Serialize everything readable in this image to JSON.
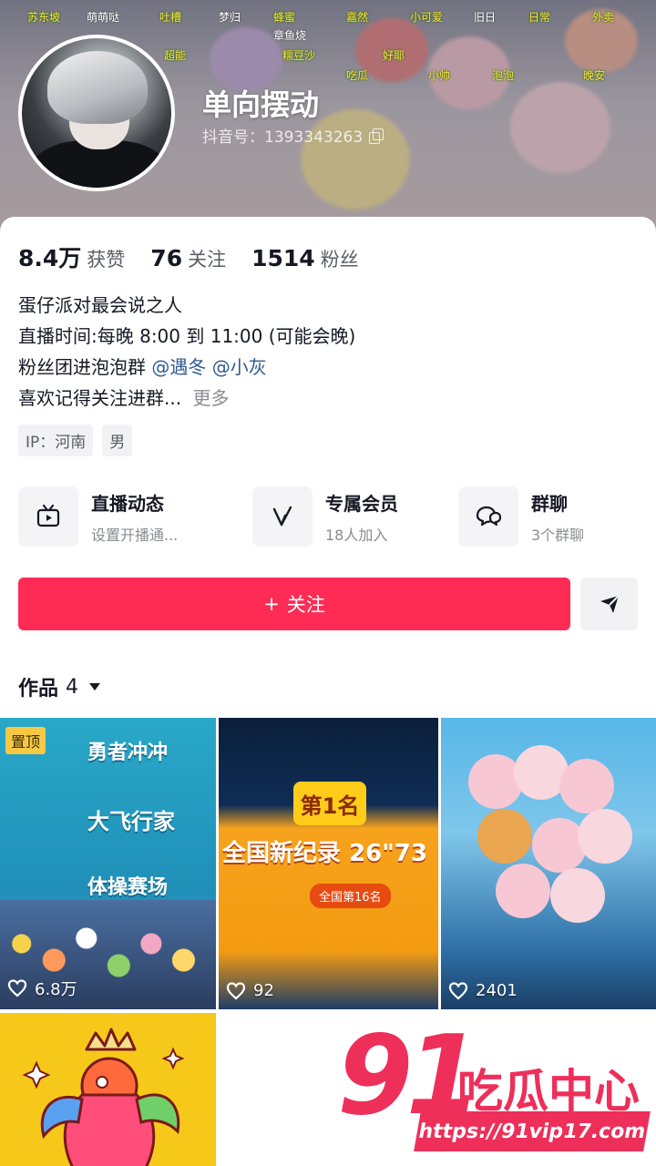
{
  "profile": {
    "username": "单向摆动",
    "douyin_id": "抖音号：1393343263"
  },
  "banner_danmaku": [
    "苏东坡",
    "萌萌哒",
    "吐槽",
    "梦归",
    "蜂蜜",
    "嘉然",
    "小可爱",
    "旧日",
    "日常",
    "外卖",
    "章鱼烧",
    "糯豆沙",
    "好耶",
    "超能",
    "小帅",
    "泡泡",
    "吃瓜",
    "晚安"
  ],
  "stats": [
    {
      "num": "8.4万",
      "label": "获赞"
    },
    {
      "num": "76",
      "label": "关注"
    },
    {
      "num": "1514",
      "label": "粉丝"
    }
  ],
  "bio": {
    "line1": "蛋仔派对最会说之人",
    "line2": "直播时间:每晚 8:00 到 11:00 (可能会晚)",
    "line3_prefix": "粉丝团进泡泡群",
    "mention1": "@遇冬",
    "mention2": "@小灰",
    "line4": "喜欢记得关注进群...",
    "more": "更多"
  },
  "tags": [
    "IP：河南",
    "男"
  ],
  "features": [
    {
      "title": "直播动态",
      "sub": "设置开播通...",
      "icon": "tv-icon"
    },
    {
      "title": "专属会员",
      "sub": "18人加入",
      "icon": "v-icon"
    },
    {
      "title": "群聊",
      "sub": "3个群聊",
      "icon": "chat-icon"
    }
  ],
  "follow_label": "关注",
  "follow_plus": "+",
  "works": {
    "label": "作品",
    "count": "4"
  },
  "videos": [
    {
      "likes": "6.8万",
      "pinned": "置顶",
      "lines": [
        "勇者冲冲",
        "大飞行家",
        "体操赛场"
      ]
    },
    {
      "likes": "92",
      "rank": "第1名",
      "record": "全国新纪录 26\"73",
      "pill": "全国第16名"
    },
    {
      "likes": "2401"
    },
    {}
  ],
  "watermark": {
    "num": "91",
    "cn": "吃瓜中心",
    "url": "https://91vip17.com"
  },
  "colors": {
    "accent": "#fe2c55",
    "mention": "#2f5a8f",
    "watermark": "#ee2f5a"
  }
}
